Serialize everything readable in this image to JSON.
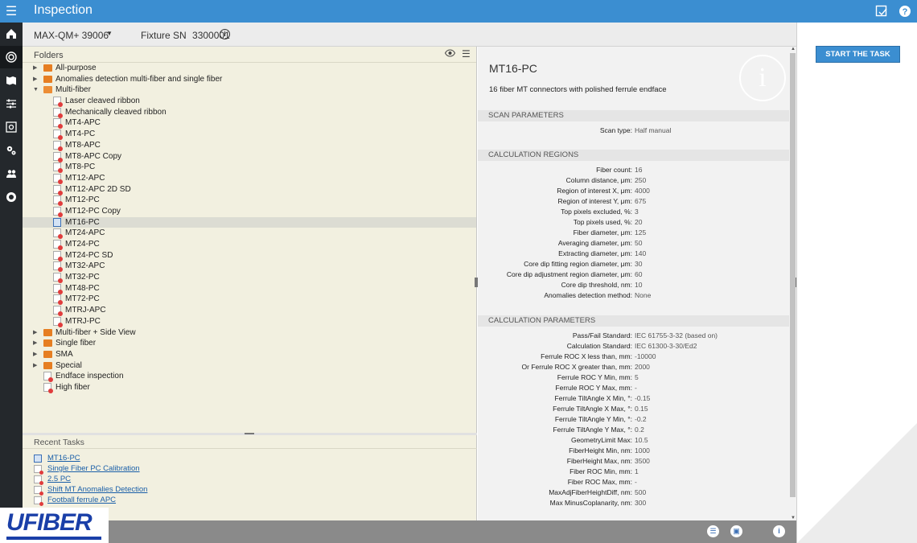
{
  "app": {
    "title": "Inspection"
  },
  "subheader": {
    "device": "MAX-QM+ 39006",
    "fixture_label": "Fixture SN",
    "fixture_sn": "3300001"
  },
  "folders": {
    "title": "Folders",
    "tree": [
      {
        "label": "All-purpose",
        "type": "folder",
        "level": 0,
        "expanded": false
      },
      {
        "label": "Anomalies detection multi-fiber and single fiber",
        "type": "folder",
        "level": 0,
        "expanded": false
      },
      {
        "label": "Multi-fiber",
        "type": "folder",
        "level": 0,
        "expanded": true
      },
      {
        "label": "Laser cleaved ribbon",
        "type": "file",
        "level": 1
      },
      {
        "label": "Mechanically cleaved ribbon",
        "type": "file",
        "level": 1
      },
      {
        "label": "MT4-APC",
        "type": "file",
        "level": 1
      },
      {
        "label": "MT4-PC",
        "type": "file",
        "level": 1
      },
      {
        "label": "MT8-APC",
        "type": "file",
        "level": 1
      },
      {
        "label": "MT8-APC Copy",
        "type": "file",
        "level": 1
      },
      {
        "label": "MT8-PC",
        "type": "file",
        "level": 1
      },
      {
        "label": "MT12-APC",
        "type": "file",
        "level": 1
      },
      {
        "label": "MT12-APC 2D SD",
        "type": "file",
        "level": 1
      },
      {
        "label": "MT12-PC",
        "type": "file",
        "level": 1
      },
      {
        "label": "MT12-PC Copy",
        "type": "file",
        "level": 1
      },
      {
        "label": "MT16-PC",
        "type": "file",
        "level": 1,
        "selected": true
      },
      {
        "label": "MT24-APC",
        "type": "file",
        "level": 1
      },
      {
        "label": "MT24-PC",
        "type": "file",
        "level": 1
      },
      {
        "label": "MT24-PC SD",
        "type": "file",
        "level": 1
      },
      {
        "label": "MT32-APC",
        "type": "file",
        "level": 1
      },
      {
        "label": "MT32-PC",
        "type": "file",
        "level": 1
      },
      {
        "label": "MT48-PC",
        "type": "file",
        "level": 1
      },
      {
        "label": "MT72-PC",
        "type": "file",
        "level": 1
      },
      {
        "label": "MTRJ-APC",
        "type": "file",
        "level": 1
      },
      {
        "label": "MTRJ-PC",
        "type": "file",
        "level": 1
      },
      {
        "label": "Multi-fiber + Side View",
        "type": "folder",
        "level": 0,
        "expanded": false
      },
      {
        "label": "Single fiber",
        "type": "folder",
        "level": 0,
        "expanded": false
      },
      {
        "label": "SMA",
        "type": "folder",
        "level": 0,
        "expanded": false
      },
      {
        "label": "Special",
        "type": "folder",
        "level": 0,
        "expanded": false
      },
      {
        "label": "Endface inspection",
        "type": "file",
        "level": 0
      },
      {
        "label": "High fiber",
        "type": "file",
        "level": 0
      }
    ]
  },
  "recent": {
    "title": "Recent Tasks",
    "items": [
      {
        "label": "MT16-PC",
        "selected": true
      },
      {
        "label": "Single Fiber PC Calibration"
      },
      {
        "label": "2.5 PC"
      },
      {
        "label": "Shift MT Anomalies Detection"
      },
      {
        "label": "Football ferrule APC"
      }
    ]
  },
  "details": {
    "title": "MT16-PC",
    "description": "16 fiber MT connectors with polished ferrule endface",
    "sections": [
      {
        "title": "SCAN PARAMETERS",
        "rows": [
          {
            "key": "Scan type:",
            "value": "Half manual"
          }
        ]
      },
      {
        "title": "CALCULATION REGIONS",
        "rows": [
          {
            "key": "Fiber count:",
            "value": "16"
          },
          {
            "key": "Column distance, μm:",
            "value": "250"
          },
          {
            "key": "Region of interest X, μm:",
            "value": "4000"
          },
          {
            "key": "Region of interest Y, μm:",
            "value": "675"
          },
          {
            "key": "Top pixels excluded, %:",
            "value": "3"
          },
          {
            "key": "Top pixels used, %:",
            "value": "20"
          },
          {
            "key": "Fiber diameter, μm:",
            "value": "125"
          },
          {
            "key": "Averaging diameter, μm:",
            "value": "50"
          },
          {
            "key": "Extracting diameter, μm:",
            "value": "140"
          },
          {
            "key": "Core dip fitting region diameter, μm:",
            "value": "30"
          },
          {
            "key": "Core dip adjustment region diameter, μm:",
            "value": "60"
          },
          {
            "key": "Core dip threshold, nm:",
            "value": "10"
          },
          {
            "key": "Anomalies detection method:",
            "value": "None"
          }
        ]
      },
      {
        "title": "CALCULATION PARAMETERS",
        "rows": [
          {
            "key": "Pass/Fail Standard:",
            "value": "IEC 61755-3-32 (based on)"
          },
          {
            "key": "Calculation Standard:",
            "value": "IEC 61300-3-30/Ed2"
          },
          {
            "key": "Ferrule ROC X less than, mm:",
            "value": "-10000"
          },
          {
            "key": "Or Ferrule ROC X greater than, mm:",
            "value": "2000"
          },
          {
            "key": "Ferrule ROC Y Min, mm:",
            "value": "5"
          },
          {
            "key": "Ferrule ROC Y Max, mm:",
            "value": "-"
          },
          {
            "key": "Ferrule TiltAngle X Min, °:",
            "value": "-0.15"
          },
          {
            "key": "Ferrule TiltAngle X Max, °:",
            "value": "0.15"
          },
          {
            "key": "Ferrule TiltAngle Y Min, °:",
            "value": "-0.2"
          },
          {
            "key": "Ferrule TiltAngle Y Max, °:",
            "value": "0.2"
          },
          {
            "key": "GeometryLimit Max:",
            "value": "10.5"
          },
          {
            "key": "FiberHeight Min, nm:",
            "value": "1000"
          },
          {
            "key": "FiberHeight Max, nm:",
            "value": "3500"
          },
          {
            "key": "Fiber ROC Min, mm:",
            "value": "1"
          },
          {
            "key": "Fiber ROC Max, mm:",
            "value": "-"
          },
          {
            "key": "MaxAdjFiberHeightDiff, nm:",
            "value": "500"
          },
          {
            "key": "Max MinusCoplanarity, nm:",
            "value": "300"
          }
        ]
      }
    ]
  },
  "actions": {
    "start_task": "START THE TASK"
  },
  "logo": {
    "text": "UFIBER"
  },
  "icons": {
    "menu": "hamburger-icon",
    "top_right": [
      "report-icon",
      "help-icon"
    ],
    "sidebar": [
      "home-icon",
      "inspection-icon",
      "map-icon",
      "sliders-icon",
      "gallery-icon",
      "gears-icon",
      "users-icon",
      "support-icon"
    ],
    "bottom": [
      "list-icon",
      "folder-icon",
      "info-icon"
    ]
  },
  "colors": {
    "topbar": "#3b8ed1",
    "sidebar": "#24282c",
    "panel": "#f2f0e0",
    "accent": "#3b8ed1",
    "file_dot": "#e03c3c",
    "folder": "#e67e22"
  }
}
